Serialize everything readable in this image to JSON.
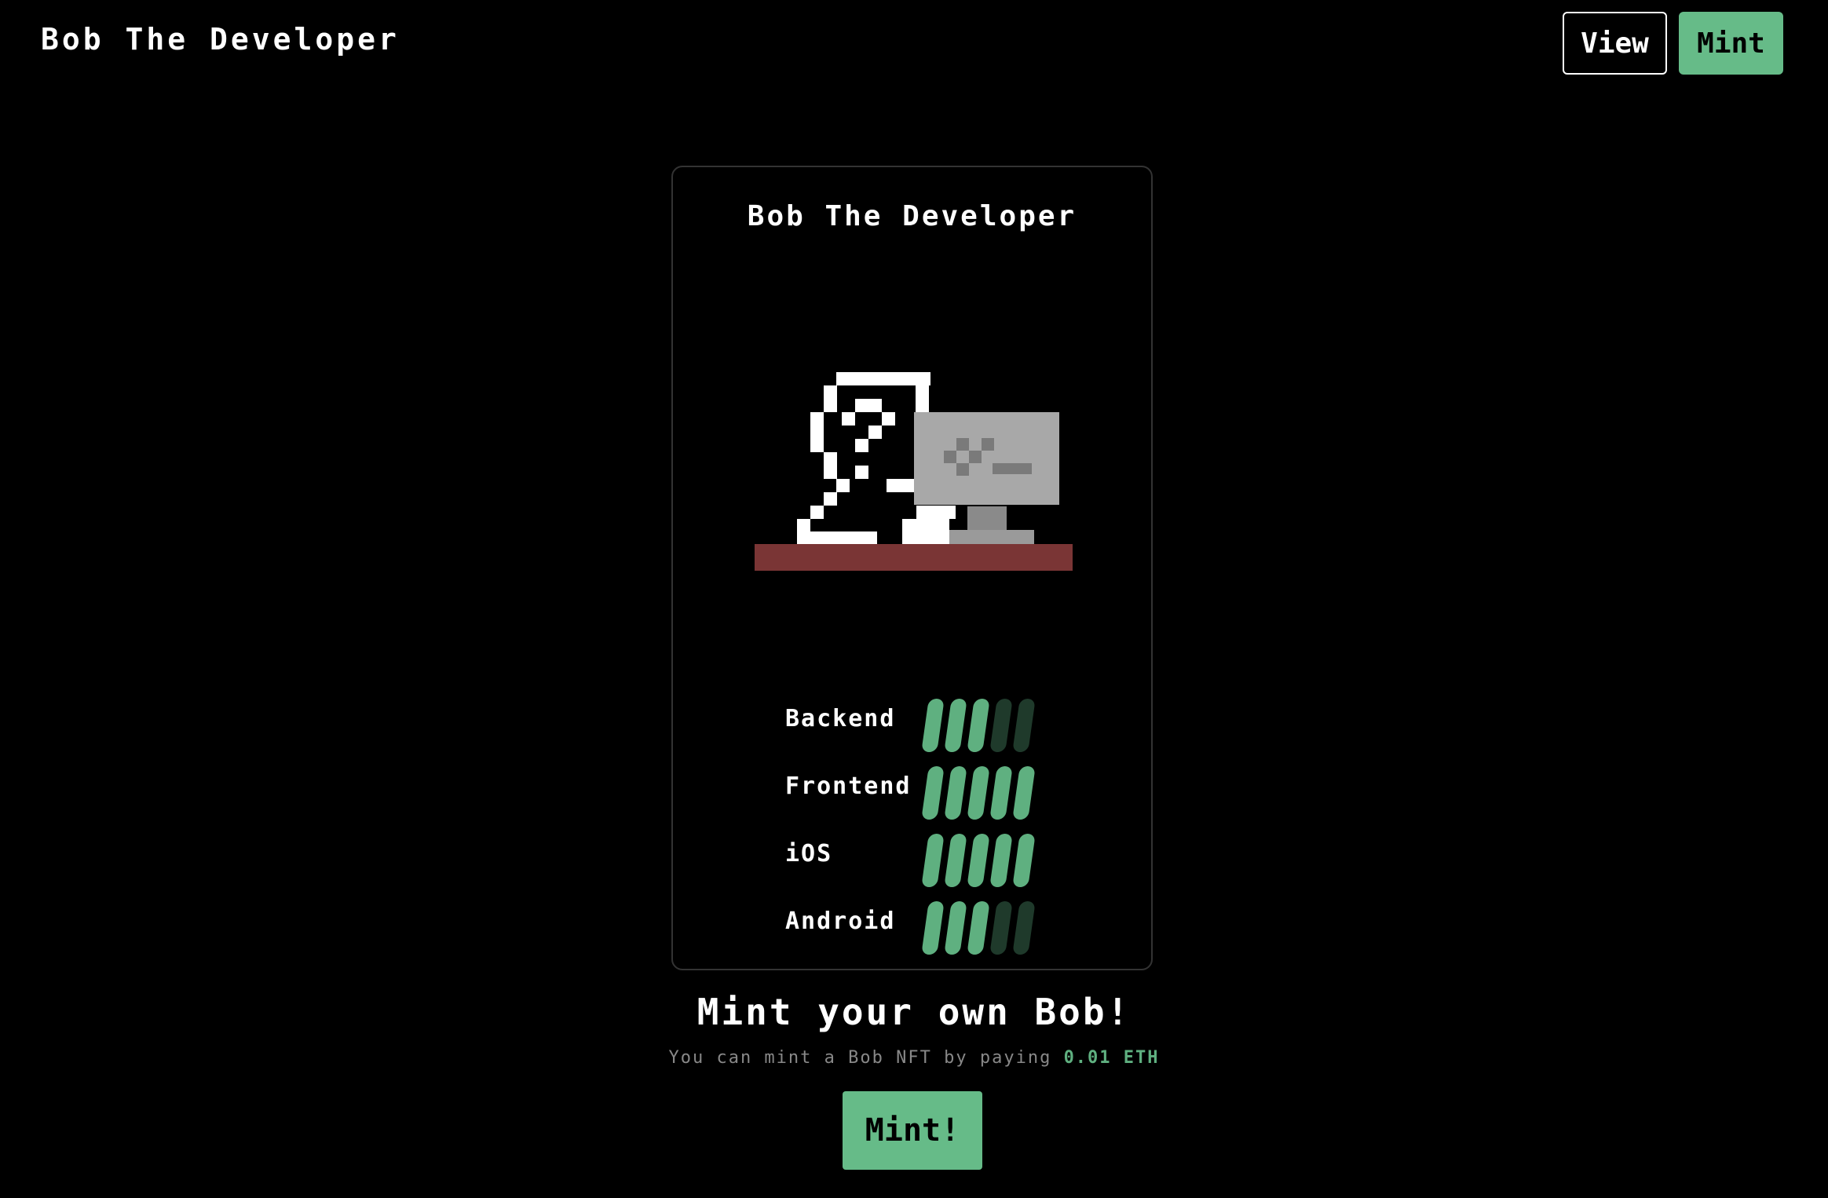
{
  "header": {
    "brand": "Bob The Developer",
    "nav": {
      "view_label": "View",
      "mint_label": "Mint"
    }
  },
  "card": {
    "title": "Bob The Developer",
    "stats": [
      {
        "label": "Backend",
        "level": 3,
        "max": 5
      },
      {
        "label": "Frontend",
        "level": 5,
        "max": 5
      },
      {
        "label": "iOS",
        "level": 5,
        "max": 5
      },
      {
        "label": "Android",
        "level": 3,
        "max": 5
      }
    ]
  },
  "cta": {
    "heading": "Mint your own Bob!",
    "subtitle_prefix": "You can mint a Bob NFT by paying",
    "price": "0.01 ETH",
    "button_label": "Mint!"
  },
  "colors": {
    "background": "#000000",
    "accent": "#66bb88",
    "pip_on": "#5fb080",
    "pip_off": "#1f3a2b",
    "desk": "#7a3535",
    "monitor": "#a8a8a8"
  },
  "icons": {
    "avatar": "pixel-developer-at-computer"
  }
}
